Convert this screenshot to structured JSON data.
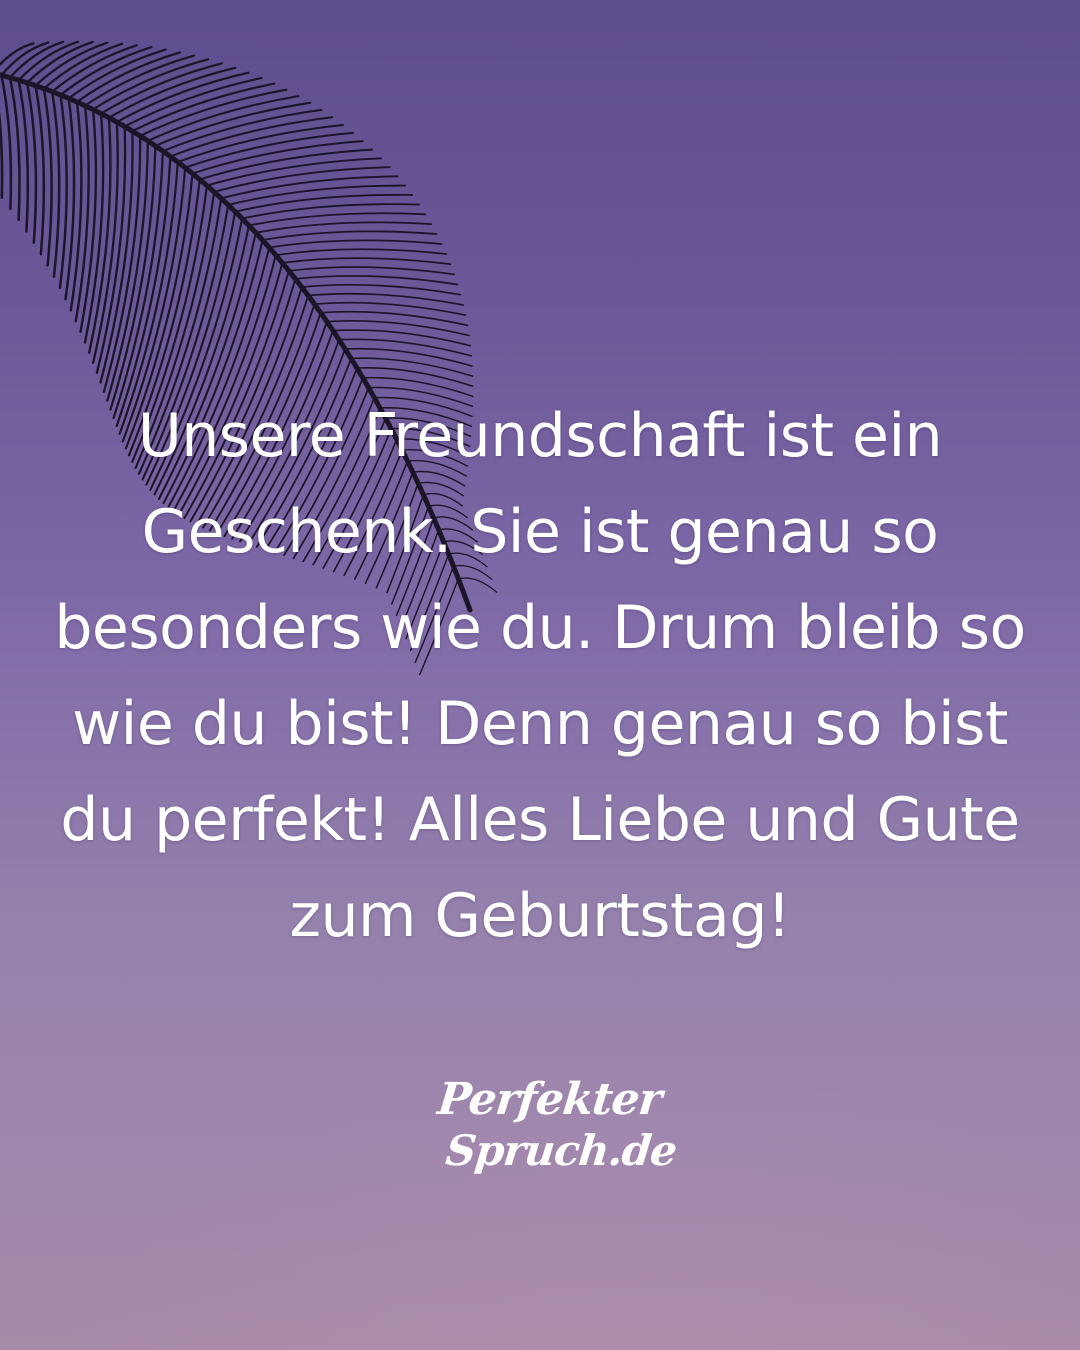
{
  "quote": {
    "text": "Unsere Freundschaft ist ein Geschenk. Sie ist genau so besonders wie du. Drum bleib so wie du bist! Denn genau so bist du perfekt! Alles Liebe und Gute zum Geburtstag!"
  },
  "logo": {
    "line1": "Perfekter",
    "line2": "Spruch.de"
  },
  "colors": {
    "sky_top": "#5e4d8e",
    "sky_bottom": "#a88aa9",
    "text": "#ffffff",
    "palm": "#1c1528"
  },
  "icons": {
    "decoration": "palm-leaf-silhouette"
  }
}
